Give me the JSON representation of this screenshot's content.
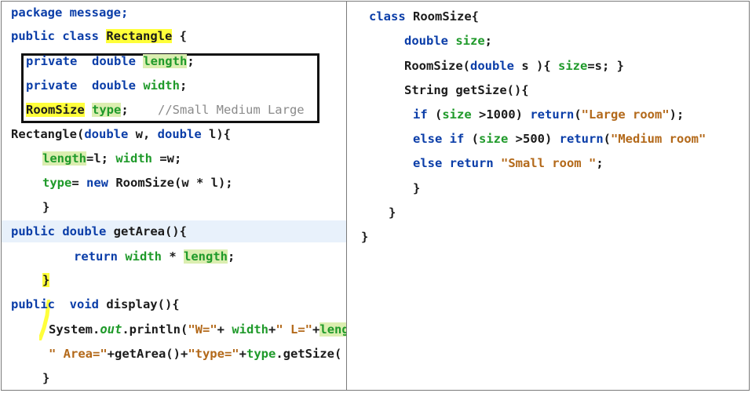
{
  "left": {
    "lines": [
      [
        {
          "t": "package message;",
          "c": "kw"
        }
      ],
      [
        {
          "t": "public class ",
          "c": "kw"
        },
        {
          "t": "Rectangle",
          "c": "hl"
        },
        {
          "t": " {",
          "c": ""
        }
      ],
      [
        {
          "t": "private  double ",
          "c": "kw"
        },
        {
          "t": "length",
          "c": "fld hlg"
        },
        {
          "t": ";",
          "c": ""
        }
      ],
      [
        {
          "t": "private  double ",
          "c": "kw"
        },
        {
          "t": "width",
          "c": "fld"
        },
        {
          "t": ";",
          "c": ""
        }
      ],
      [
        {
          "t": "RoomSize",
          "c": "hl"
        },
        {
          "t": " ",
          "c": ""
        },
        {
          "t": "type",
          "c": "fld hlg"
        },
        {
          "t": ";    ",
          "c": ""
        },
        {
          "t": "//Small Medium Large",
          "c": "cmt"
        }
      ],
      [
        {
          "t": "Rectangle(",
          "c": ""
        },
        {
          "t": "double",
          "c": "kw"
        },
        {
          "t": " w, ",
          "c": ""
        },
        {
          "t": "double",
          "c": "kw"
        },
        {
          "t": " l){",
          "c": ""
        }
      ],
      [
        {
          "t": "length",
          "c": "fld hlg"
        },
        {
          "t": "=l; ",
          "c": ""
        },
        {
          "t": "width",
          "c": "fld"
        },
        {
          "t": " =w;",
          "c": ""
        }
      ],
      [
        {
          "t": "type",
          "c": "fld"
        },
        {
          "t": "= ",
          "c": ""
        },
        {
          "t": "new",
          "c": "kw"
        },
        {
          "t": " RoomSize(w * l);",
          "c": ""
        }
      ],
      [
        {
          "t": "}",
          "c": ""
        }
      ],
      [
        {
          "t": "public double ",
          "c": "kw"
        },
        {
          "t": "getArea(){",
          "c": ""
        }
      ],
      [
        {
          "t": "return ",
          "c": "kw"
        },
        {
          "t": "width",
          "c": "fld"
        },
        {
          "t": " * ",
          "c": ""
        },
        {
          "t": "length",
          "c": "fld hlg"
        },
        {
          "t": ";",
          "c": ""
        }
      ],
      [
        {
          "t": "}",
          "c": "hl"
        }
      ],
      [
        {
          "t": "public  ",
          "c": "kw"
        },
        {
          "t": "void",
          "c": "kw"
        },
        {
          "t": " display(){",
          "c": ""
        }
      ],
      [
        {
          "t": "System.",
          "c": ""
        },
        {
          "t": "out",
          "c": "fldi"
        },
        {
          "t": ".println(",
          "c": ""
        },
        {
          "t": "\"W=\"",
          "c": "str"
        },
        {
          "t": "+ ",
          "c": ""
        },
        {
          "t": "width",
          "c": "fld"
        },
        {
          "t": "+",
          "c": ""
        },
        {
          "t": "\" L=\"",
          "c": "str"
        },
        {
          "t": "+",
          "c": ""
        },
        {
          "t": "length",
          "c": "fld hlg"
        }
      ],
      [
        {
          "t": "\" Area=\"",
          "c": "str"
        },
        {
          "t": "+getArea()+",
          "c": ""
        },
        {
          "t": "\"type=\"",
          "c": "str"
        },
        {
          "t": "+",
          "c": ""
        },
        {
          "t": "type",
          "c": "fld"
        },
        {
          "t": ".getSize(",
          "c": ""
        }
      ],
      [
        {
          "t": "}",
          "c": ""
        }
      ]
    ]
  },
  "right": {
    "lines": [
      [
        {
          "t": "class ",
          "c": "kw"
        },
        {
          "t": "RoomSize{",
          "c": ""
        }
      ],
      [
        {
          "t": "double ",
          "c": "kw"
        },
        {
          "t": "size",
          "c": "fld"
        },
        {
          "t": ";",
          "c": ""
        }
      ],
      [
        {
          "t": "RoomSize(",
          "c": ""
        },
        {
          "t": "double",
          "c": "kw"
        },
        {
          "t": " s ){ ",
          "c": ""
        },
        {
          "t": "size",
          "c": "fld"
        },
        {
          "t": "=s; }",
          "c": ""
        }
      ],
      [
        {
          "t": "String getSize(){",
          "c": ""
        }
      ],
      [
        {
          "t": "if",
          "c": "kw"
        },
        {
          "t": " (",
          "c": ""
        },
        {
          "t": "size",
          "c": "fld"
        },
        {
          "t": " >1000) ",
          "c": ""
        },
        {
          "t": "return",
          "c": "kw"
        },
        {
          "t": "(",
          "c": ""
        },
        {
          "t": "\"Large room\"",
          "c": "str"
        },
        {
          "t": ");",
          "c": ""
        }
      ],
      [
        {
          "t": "else if",
          "c": "kw"
        },
        {
          "t": " (",
          "c": ""
        },
        {
          "t": "size",
          "c": "fld"
        },
        {
          "t": " >500) ",
          "c": ""
        },
        {
          "t": "return",
          "c": "kw"
        },
        {
          "t": "(",
          "c": ""
        },
        {
          "t": "\"Medium room\"",
          "c": "str"
        }
      ],
      [
        {
          "t": "else return ",
          "c": "kw"
        },
        {
          "t": "\"Small room \"",
          "c": "str"
        },
        {
          "t": ";",
          "c": ""
        }
      ],
      [
        {
          "t": "}",
          "c": ""
        }
      ],
      [
        {
          "t": "}",
          "c": ""
        }
      ],
      [
        {
          "t": "}",
          "c": ""
        }
      ]
    ]
  }
}
